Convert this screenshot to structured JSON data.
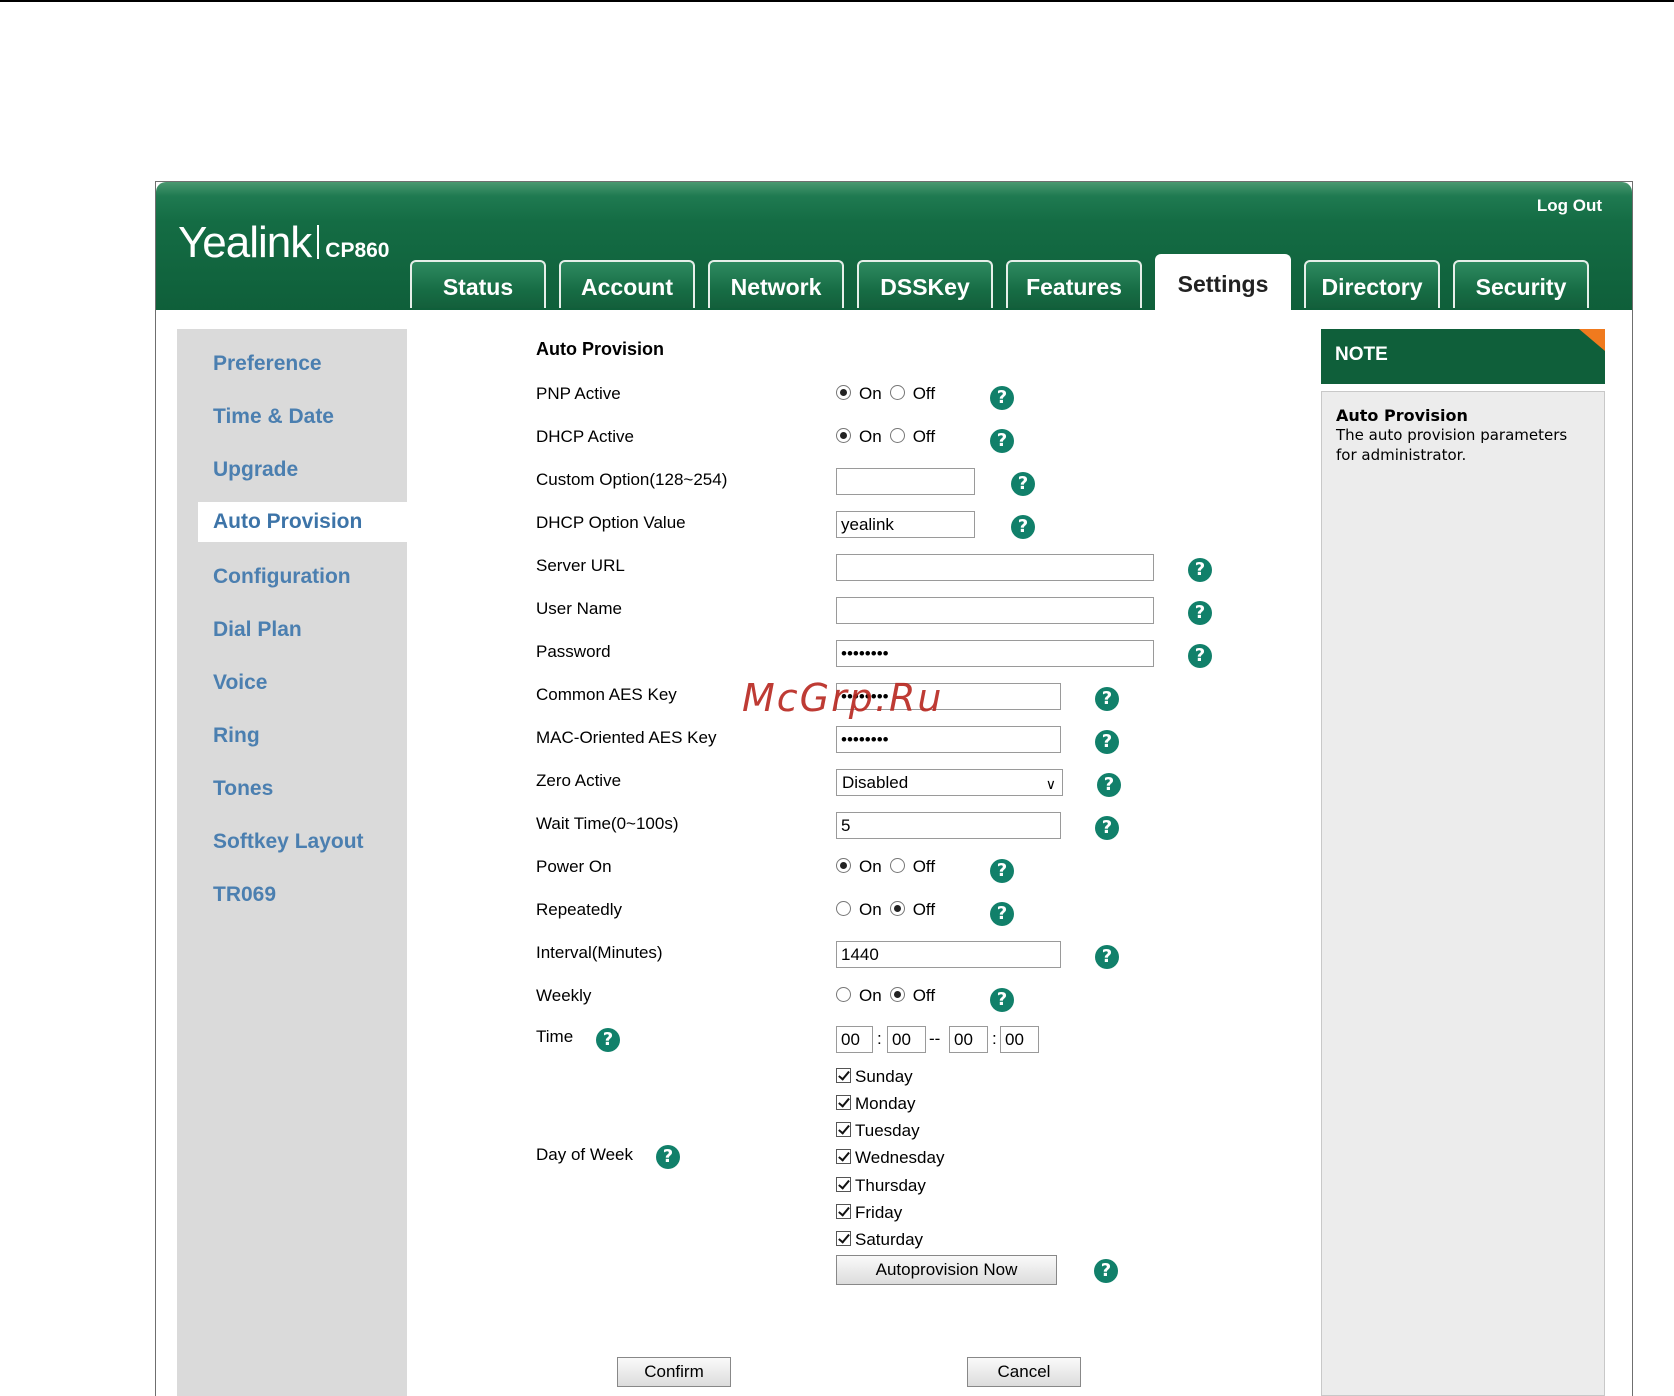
{
  "header": {
    "brand": "Yealink",
    "model": "CP860",
    "logout_label": "Log Out",
    "tabs": [
      {
        "label": "Status"
      },
      {
        "label": "Account"
      },
      {
        "label": "Network"
      },
      {
        "label": "DSSKey"
      },
      {
        "label": "Features"
      },
      {
        "label": "Settings"
      },
      {
        "label": "Directory"
      },
      {
        "label": "Security"
      }
    ],
    "active_tab": "Settings"
  },
  "sidebar": {
    "items": [
      {
        "label": "Preference"
      },
      {
        "label": "Time & Date"
      },
      {
        "label": "Upgrade"
      },
      {
        "label": "Auto Provision"
      },
      {
        "label": "Configuration"
      },
      {
        "label": "Dial Plan"
      },
      {
        "label": "Voice"
      },
      {
        "label": "Ring"
      },
      {
        "label": "Tones"
      },
      {
        "label": "Softkey Layout"
      },
      {
        "label": "TR069"
      }
    ],
    "active_item": "Auto Provision"
  },
  "form": {
    "section_title": "Auto Provision",
    "on_label": "On",
    "off_label": "Off",
    "pnp_active": {
      "label": "PNP Active",
      "value": "On"
    },
    "dhcp_active": {
      "label": "DHCP Active",
      "value": "On"
    },
    "custom_option": {
      "label": "Custom Option(128~254)",
      "value": ""
    },
    "dhcp_option_value": {
      "label": "DHCP Option Value",
      "value": "yealink"
    },
    "server_url": {
      "label": "Server URL",
      "value": ""
    },
    "user_name": {
      "label": "User Name",
      "value": ""
    },
    "password": {
      "label": "Password",
      "value": "••••••••"
    },
    "common_aes_key": {
      "label": "Common AES Key",
      "value": "••••••••"
    },
    "mac_aes_key": {
      "label": "MAC-Oriented AES Key",
      "value": "••••••••"
    },
    "zero_active": {
      "label": "Zero Active",
      "value": "Disabled"
    },
    "wait_time": {
      "label": "Wait Time(0~100s)",
      "value": "5"
    },
    "power_on": {
      "label": "Power On",
      "value": "On"
    },
    "repeatedly": {
      "label": "Repeatedly",
      "value": "Off"
    },
    "interval": {
      "label": "Interval(Minutes)",
      "value": "1440"
    },
    "weekly": {
      "label": "Weekly",
      "value": "Off"
    },
    "time": {
      "label": "Time",
      "start_hour": "00",
      "start_min": "00",
      "end_hour": "00",
      "end_min": "00",
      "colon": ":",
      "dash": "--"
    },
    "day_of_week": {
      "label": "Day of Week",
      "days": [
        {
          "label": "Sunday",
          "checked": true
        },
        {
          "label": "Monday",
          "checked": true
        },
        {
          "label": "Tuesday",
          "checked": true
        },
        {
          "label": "Wednesday",
          "checked": true
        },
        {
          "label": "Thursday",
          "checked": true
        },
        {
          "label": "Friday",
          "checked": true
        },
        {
          "label": "Saturday",
          "checked": true
        }
      ]
    },
    "autoprovision_button": "Autoprovision Now",
    "confirm_button": "Confirm",
    "cancel_button": "Cancel",
    "help_glyph": "?"
  },
  "note": {
    "heading": "NOTE",
    "title": "Auto Provision",
    "text": "The auto provision parameters for administrator."
  },
  "watermark": "McGrp.Ru",
  "colors": {
    "header_green": "#0f5f3a",
    "nav_text": "#4b7fb0",
    "help_teal": "#11806a",
    "note_corner": "#f07a1e"
  }
}
